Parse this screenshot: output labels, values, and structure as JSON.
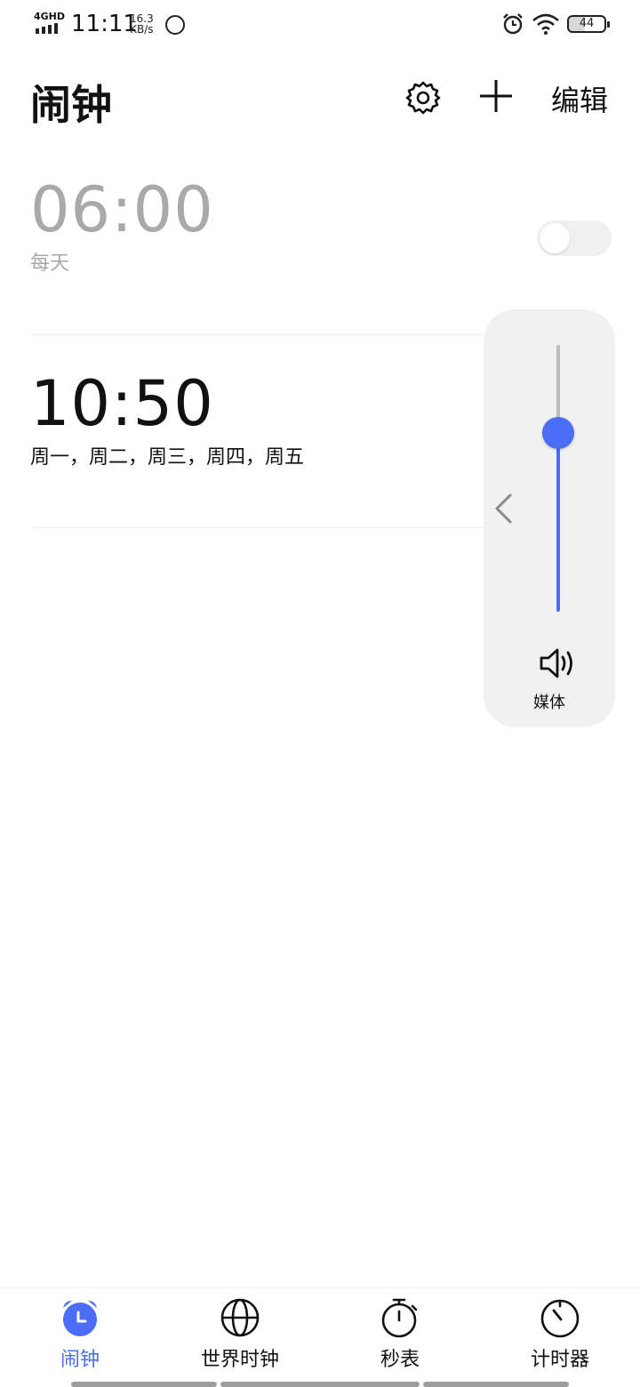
{
  "status_bar": {
    "network": "4GHD",
    "time": "11:11",
    "speed_value": "16.3",
    "speed_unit": "KB/s",
    "battery": "44"
  },
  "header": {
    "title": "闹钟",
    "edit_label": "编辑"
  },
  "alarms": [
    {
      "time": "06:00",
      "repeat": "每天",
      "enabled": false
    },
    {
      "time": "10:50",
      "repeat": "周一，周二，周三，周四，周五",
      "enabled": true
    }
  ],
  "volume_panel": {
    "label": "媒体",
    "level": 0.67
  },
  "bottom_nav": [
    {
      "label": "闹钟",
      "icon": "alarm-clock-icon",
      "active": true
    },
    {
      "label": "世界时钟",
      "icon": "globe-icon",
      "active": false
    },
    {
      "label": "秒表",
      "icon": "stopwatch-icon",
      "active": false
    },
    {
      "label": "计时器",
      "icon": "timer-icon",
      "active": false
    }
  ],
  "colors": {
    "accent": "#4a6cf7",
    "inactive_text": "#a9a9a9",
    "panel_bg": "#f1f1f1"
  }
}
